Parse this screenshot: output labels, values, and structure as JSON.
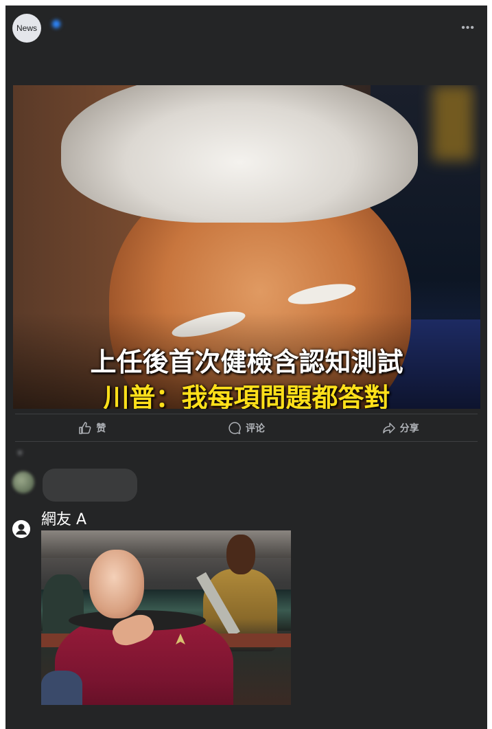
{
  "post": {
    "page_avatar_label": "News",
    "page_name": "",
    "timestamp": "",
    "text_line1_hashtag": "",
    "text_line1": "",
    "text_line2": ""
  },
  "media": {
    "caption_line1": "上任後首次健檢含認知測試",
    "caption_line2": "川普：我每項問題都答對",
    "caption_color": "#ffe01a"
  },
  "actions": [
    {
      "label": "赞",
      "icon": "thumbs-up-icon"
    },
    {
      "label": "评论",
      "icon": "comment-icon"
    },
    {
      "label": "分享",
      "icon": "share-icon"
    }
  ],
  "comments": {
    "sort_label": "",
    "first": {
      "name": "",
      "text": ""
    },
    "second": {
      "name": "網友 A",
      "attachment": "meme-image"
    }
  },
  "colors": {
    "background": "#242526",
    "text": "#e4e6eb",
    "muted": "#b0b3b8",
    "link": "#4599ff"
  }
}
